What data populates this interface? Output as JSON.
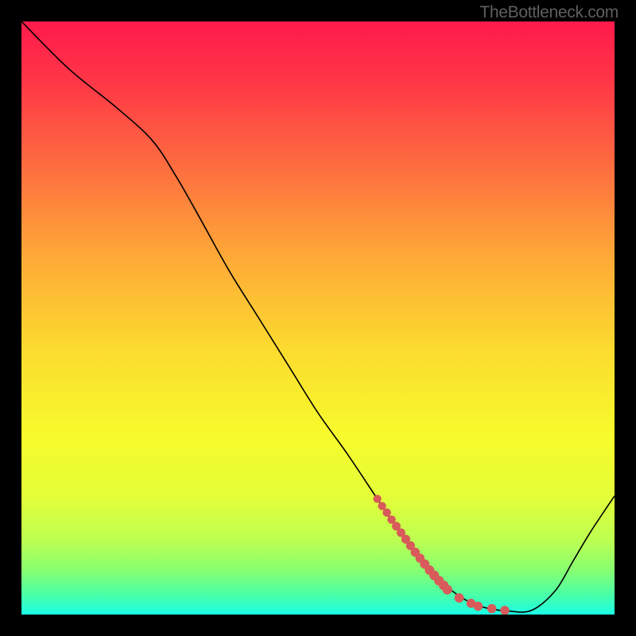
{
  "watermark": "TheBottleneck.com",
  "chart_data": {
    "type": "line",
    "title": "",
    "xlabel": "",
    "ylabel": "",
    "xlim": [
      0,
      100
    ],
    "ylim": [
      0,
      100
    ],
    "background_gradient": {
      "stops": [
        {
          "offset": 0.0,
          "color": "#ff1a4b"
        },
        {
          "offset": 0.1,
          "color": "#ff3647"
        },
        {
          "offset": 0.25,
          "color": "#fe6f3f"
        },
        {
          "offset": 0.4,
          "color": "#feaa37"
        },
        {
          "offset": 0.55,
          "color": "#fcda2f"
        },
        {
          "offset": 0.7,
          "color": "#f7fb2c"
        },
        {
          "offset": 0.8,
          "color": "#e4fe38"
        },
        {
          "offset": 0.875,
          "color": "#bcff51"
        },
        {
          "offset": 0.925,
          "color": "#88ff70"
        },
        {
          "offset": 0.965,
          "color": "#4cffa5"
        },
        {
          "offset": 1.0,
          "color": "#1bffe6"
        }
      ]
    },
    "series": [
      {
        "name": "curve",
        "stroke": "#000000",
        "x": [
          0,
          8,
          16,
          22,
          26,
          30,
          35,
          40,
          45,
          50,
          55,
          60,
          63,
          66,
          69,
          72,
          75,
          78,
          82,
          86,
          90,
          93,
          96,
          100
        ],
        "y": [
          100,
          92,
          85.5,
          80,
          74,
          67,
          58,
          50,
          42,
          34,
          27,
          19.5,
          15,
          11,
          7.5,
          4.5,
          2.4,
          1.2,
          0.6,
          0.7,
          4,
          9,
          14,
          20
        ]
      }
    ],
    "highlight_points": {
      "name": "marker-trail",
      "color": "#d85a5a",
      "points": [
        {
          "x": 60.0,
          "y": 19.5,
          "r": 3.2
        },
        {
          "x": 60.8,
          "y": 18.3,
          "r": 3.2
        },
        {
          "x": 61.6,
          "y": 17.2,
          "r": 3.3
        },
        {
          "x": 62.4,
          "y": 16.0,
          "r": 3.3
        },
        {
          "x": 63.2,
          "y": 14.9,
          "r": 3.4
        },
        {
          "x": 64.0,
          "y": 13.8,
          "r": 3.4
        },
        {
          "x": 64.8,
          "y": 12.7,
          "r": 3.5
        },
        {
          "x": 65.6,
          "y": 11.6,
          "r": 3.5
        },
        {
          "x": 66.4,
          "y": 10.5,
          "r": 3.6
        },
        {
          "x": 67.2,
          "y": 9.5,
          "r": 3.6
        },
        {
          "x": 68.0,
          "y": 8.5,
          "r": 3.7
        },
        {
          "x": 68.8,
          "y": 7.5,
          "r": 3.7
        },
        {
          "x": 69.6,
          "y": 6.6,
          "r": 3.8
        },
        {
          "x": 70.4,
          "y": 5.7,
          "r": 3.8
        },
        {
          "x": 71.2,
          "y": 4.9,
          "r": 3.8
        },
        {
          "x": 71.8,
          "y": 4.2,
          "r": 3.8
        },
        {
          "x": 73.8,
          "y": 2.8,
          "r": 3.7
        },
        {
          "x": 75.8,
          "y": 1.9,
          "r": 3.6
        },
        {
          "x": 77.0,
          "y": 1.4,
          "r": 3.6
        },
        {
          "x": 79.3,
          "y": 1.0,
          "r": 3.6
        },
        {
          "x": 81.5,
          "y": 0.7,
          "r": 3.6
        }
      ]
    }
  }
}
